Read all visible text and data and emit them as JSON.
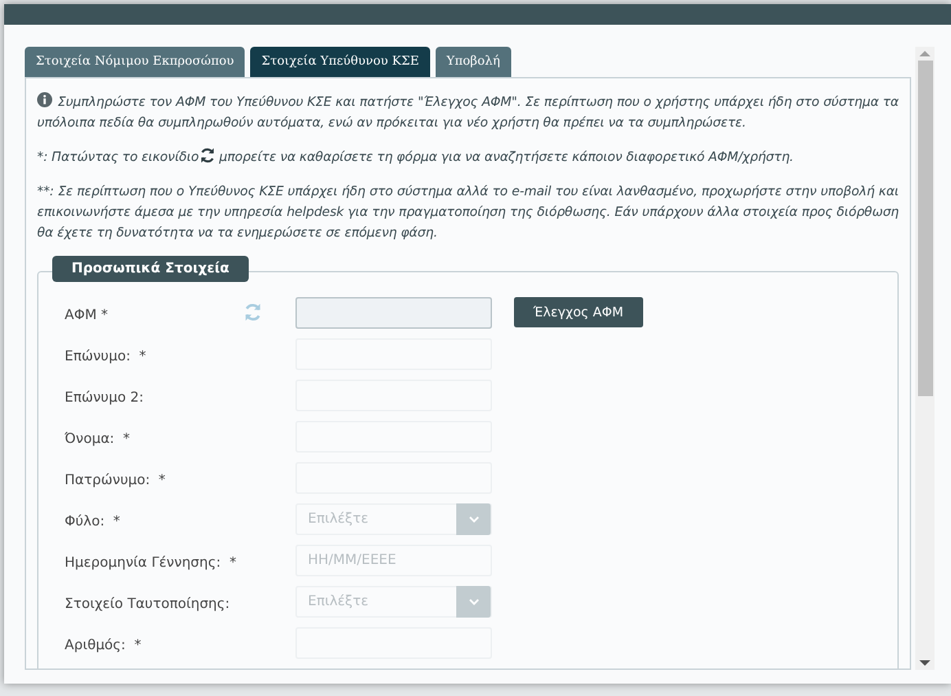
{
  "tabs": [
    {
      "label": "Στοιχεία Νόμιμου Εκπροσώπου",
      "selected": false
    },
    {
      "label": "Στοιχεία Υπεύθυνου ΚΣΕ",
      "selected": true
    },
    {
      "label": "Υποβολή",
      "selected": false
    }
  ],
  "info": {
    "main": "Συμπληρώστε τον ΑΦΜ του Υπεύθυνου ΚΣΕ και πατήστε \"Έλεγχος ΑΦΜ\". Σε περίπτωση που ο χρήστης υπάρχει ήδη στο σύστημα τα υπόλοιπα πεδία θα συμπληρωθούν αυτόματα, ενώ αν πρόκειται για νέο χρήστη θα πρέπει να τα συμπληρώσετε.",
    "reset_before": "*: Πατώντας το εικονίδιο",
    "reset_after": "μπορείτε να καθαρίσετε τη φόρμα για να αναζητήσετε κάποιον διαφορετικό ΑΦΜ/χρήστη.",
    "note": "**: Σε περίπτωση που ο Υπεύθυνος ΚΣΕ υπάρχει ήδη στο σύστημα αλλά το e-mail του είναι λανθασμένο, προχωρήστε στην υποβολή και επικοινωνήστε άμεσα με την υπηρεσία helpdesk για την πραγματοποίηση της διόρθωσης. Εάν υπάρχουν άλλα στοιχεία προς διόρθωση θα έχετε τη δυνατότητα να τα ενημερώσετε σε επόμενη φάση."
  },
  "section": {
    "title": "Προσωπικά Στοιχεία",
    "fields": [
      {
        "label": "ΑΦΜ *",
        "kind": "afm",
        "button": "Έλεγχος ΑΦΜ"
      },
      {
        "label": "Επώνυμο:  *",
        "kind": "text"
      },
      {
        "label": "Επώνυμο 2:",
        "kind": "text"
      },
      {
        "label": "Όνομα:  *",
        "kind": "text"
      },
      {
        "label": "Πατρώνυμο:  *",
        "kind": "text"
      },
      {
        "label": "Φύλο:  *",
        "kind": "select",
        "placeholder": "Επιλέξτε"
      },
      {
        "label": "Ημερομηνία Γέννησης:  *",
        "kind": "text",
        "placeholder": "ΗΗ/ΜΜ/ΕΕΕΕ"
      },
      {
        "label": "Στοιχείο Ταυτοποίησης:",
        "kind": "select",
        "placeholder": "Επιλέξτε"
      },
      {
        "label": "Αριθμός:  *",
        "kind": "text"
      }
    ]
  }
}
